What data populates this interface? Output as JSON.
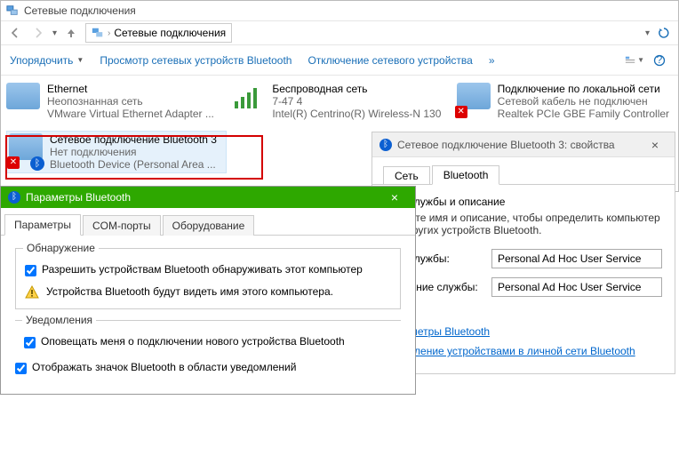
{
  "window": {
    "title": "Сетевые подключения",
    "breadcrumb": "Сетевые подключения"
  },
  "cmdbar": {
    "organize": "Упорядочить",
    "view_bt": "Просмотр сетевых устройств Bluetooth",
    "disable": "Отключение сетевого устройства",
    "chev": "»"
  },
  "connections": [
    {
      "title": "Ethernet",
      "sub1": "Неопознанная сеть",
      "sub2": "VMware Virtual Ethernet Adapter ..."
    },
    {
      "title": "Беспроводная сеть",
      "sub1": "7-47  4",
      "sub2": "Intel(R) Centrino(R) Wireless-N 130"
    },
    {
      "title": "Подключение по локальной сети",
      "sub1": "Сетевой кабель не подключен",
      "sub2": "Realtek PCIe GBE Family Controller"
    },
    {
      "title": "Сетевое подключение Bluetooth 3",
      "sub1": "Нет подключения",
      "sub2": "Bluetooth Device (Personal Area ..."
    }
  ],
  "dlg1": {
    "title": "Параметры Bluetooth",
    "tabs": {
      "t1": "Параметры",
      "t2": "COM-порты",
      "t3": "Оборудование"
    },
    "group1_title": "Обнаружение",
    "allow_discover": "Разрешить устройствам Bluetooth обнаруживать этот компьютер",
    "warn": "Устройства Bluetooth будут видеть имя этого компьютера.",
    "group2_title": "Уведомления",
    "notify": "Оповещать меня о подключении нового устройства Bluetooth",
    "show_icon": "Отображать значок Bluetooth в области уведомлений"
  },
  "dlg2": {
    "title": "Сетевое подключение Bluetooth 3: свойства",
    "tabs": {
      "t1": "Сеть",
      "t2": "Bluetooth"
    },
    "sect_title": "Имя службы и описание",
    "sect_desc": "Введите имя и описание, чтобы определить компьютер для других устройств Bluetooth.",
    "lbl_name": "Имя службы:",
    "lbl_desc": "Описание службы:",
    "val_name": "Personal Ad Hoc User Service",
    "val_desc": "Personal Ad Hoc User Service",
    "link1": "Параметры Bluetooth",
    "link2": "Управление устройствами в личной сети Bluetooth"
  }
}
